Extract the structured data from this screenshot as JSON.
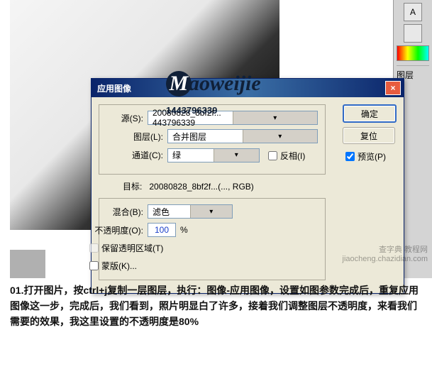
{
  "dialog": {
    "title": "应用图像",
    "buttons": {
      "ok": "确定",
      "reset": "复位",
      "preview": "预览(P)"
    },
    "source": {
      "label": "源(S):",
      "value": "20080828_8bf2f... 443796339",
      "layer_label": "图层(L):",
      "layer_value": "合并图层",
      "channel_label": "通道(C):",
      "channel_value": "绿",
      "invert": "反相(I)"
    },
    "target": {
      "label": "目标:",
      "value": "20080828_8bf2f...(..., RGB)"
    },
    "blend": {
      "label": "混合(B):",
      "value": "滤色",
      "opacity_label": "不透明度(O):",
      "opacity_value": "100",
      "opacity_unit": "%",
      "preserve_trans": "保留透明区域(T)",
      "mask": "蒙版(K)..."
    }
  },
  "sidebar": {
    "icon_letter": "A",
    "layers": "图层"
  },
  "watermark": {
    "logo_letter": "M",
    "logo_rest": "aoweijie",
    "id": "1443796339",
    "footer1": "查字典 教程网",
    "footer2": "jiaocheng.chazidian.com"
  },
  "caption": {
    "step": "01",
    "text": ".打开图片，按ctrl+j复制一层图层，执行：图像-应用图像，设置如图参数完成后，重复应用图像这一步，完成后，我们看到，照片明显白了许多，接着我们调整图层不透明度，来看我们需要的效果，我这里设置的不透明度是80%"
  }
}
